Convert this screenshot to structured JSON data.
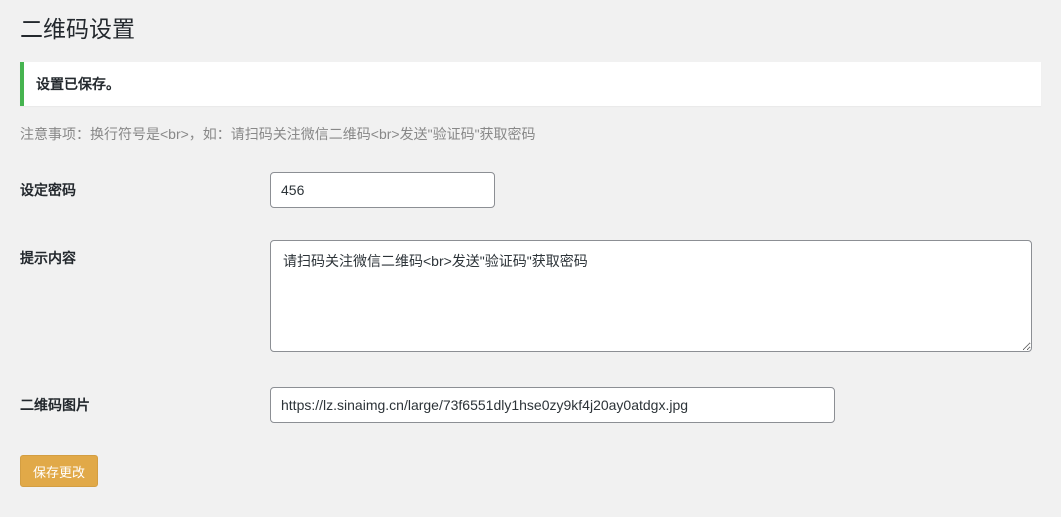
{
  "page": {
    "title": "二维码设置"
  },
  "notice": {
    "message": "设置已保存。"
  },
  "helper": "注意事项：换行符号是<br>，如：请扫码关注微信二维码<br>发送\"验证码\"获取密码",
  "form": {
    "password": {
      "label": "设定密码",
      "value": "456"
    },
    "hint": {
      "label": "提示内容",
      "value": "请扫码关注微信二维码<br>发送\"验证码\"获取密码"
    },
    "qr_image": {
      "label": "二维码图片",
      "value": "https://lz.sinaimg.cn/large/73f6551dly1hse0zy9kf4j20ay0atdgx.jpg"
    },
    "submit": {
      "label": "保存更改"
    }
  }
}
